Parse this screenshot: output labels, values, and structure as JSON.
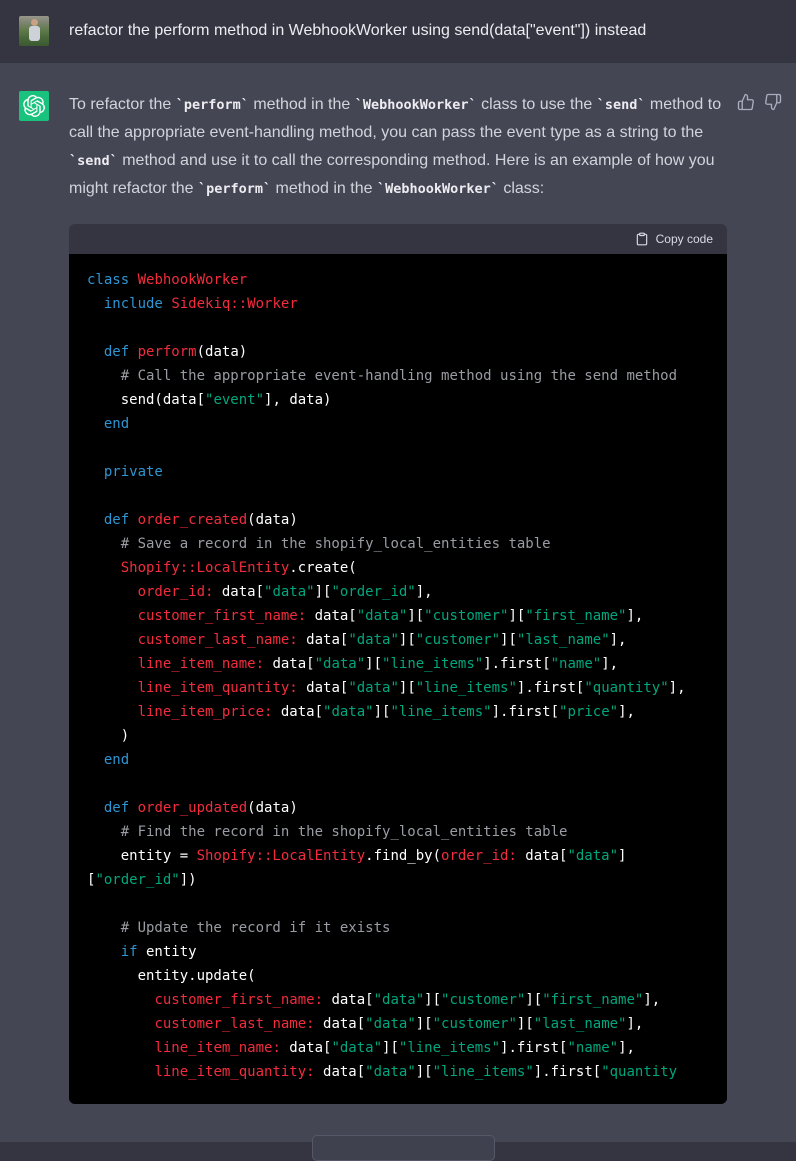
{
  "user_message": {
    "text": "refactor the perform method in WebhookWorker using send(data[\"event\"]) instead"
  },
  "assistant": {
    "paragraph": [
      {
        "v": "To refactor the "
      },
      {
        "v": "`perform`",
        "c": true
      },
      {
        "v": " method in the "
      },
      {
        "v": "`WebhookWorker`",
        "c": true
      },
      {
        "v": " class to use the "
      },
      {
        "v": "`send`",
        "c": true
      },
      {
        "v": " method to call the appropriate event-handling method, you can pass the event type as a string to the "
      },
      {
        "v": "`send`",
        "c": true
      },
      {
        "v": " method and use it to call the corresponding method. Here is an example of how you might refactor the "
      },
      {
        "v": "`perform`",
        "c": true
      },
      {
        "v": " method in the "
      },
      {
        "v": "`WebhookWorker`",
        "c": true
      },
      {
        "v": " class:"
      }
    ]
  },
  "code_block": {
    "copy_label": "Copy code",
    "lines": [
      [
        [
          "k",
          "class"
        ],
        [
          "p",
          " "
        ],
        [
          "t",
          "WebhookWorker"
        ]
      ],
      [
        [
          "p",
          "  "
        ],
        [
          "k",
          "include"
        ],
        [
          "p",
          " "
        ],
        [
          "t",
          "Sidekiq::Worker"
        ]
      ],
      [],
      [
        [
          "p",
          "  "
        ],
        [
          "k",
          "def"
        ],
        [
          "p",
          " "
        ],
        [
          "t",
          "perform"
        ],
        [
          "p",
          "(data)"
        ]
      ],
      [
        [
          "p",
          "    "
        ],
        [
          "c",
          "# Call the appropriate event-handling method using the send method"
        ]
      ],
      [
        [
          "p",
          "    send(data["
        ],
        [
          "s",
          "\"event\""
        ],
        [
          "p",
          "], data)"
        ]
      ],
      [
        [
          "p",
          "  "
        ],
        [
          "k",
          "end"
        ]
      ],
      [],
      [
        [
          "p",
          "  "
        ],
        [
          "k",
          "private"
        ]
      ],
      [],
      [
        [
          "p",
          "  "
        ],
        [
          "k",
          "def"
        ],
        [
          "p",
          " "
        ],
        [
          "t",
          "order_created"
        ],
        [
          "p",
          "(data)"
        ]
      ],
      [
        [
          "p",
          "    "
        ],
        [
          "c",
          "# Save a record in the shopify_local_entities table"
        ]
      ],
      [
        [
          "p",
          "    "
        ],
        [
          "t",
          "Shopify::LocalEntity"
        ],
        [
          "p",
          ".create("
        ]
      ],
      [
        [
          "p",
          "      "
        ],
        [
          "t",
          "order_id:"
        ],
        [
          "p",
          " data["
        ],
        [
          "s",
          "\"data\""
        ],
        [
          "p",
          "]["
        ],
        [
          "s",
          "\"order_id\""
        ],
        [
          "p",
          "],"
        ]
      ],
      [
        [
          "p",
          "      "
        ],
        [
          "t",
          "customer_first_name:"
        ],
        [
          "p",
          " data["
        ],
        [
          "s",
          "\"data\""
        ],
        [
          "p",
          "]["
        ],
        [
          "s",
          "\"customer\""
        ],
        [
          "p",
          "]["
        ],
        [
          "s",
          "\"first_name\""
        ],
        [
          "p",
          "],"
        ]
      ],
      [
        [
          "p",
          "      "
        ],
        [
          "t",
          "customer_last_name:"
        ],
        [
          "p",
          " data["
        ],
        [
          "s",
          "\"data\""
        ],
        [
          "p",
          "]["
        ],
        [
          "s",
          "\"customer\""
        ],
        [
          "p",
          "]["
        ],
        [
          "s",
          "\"last_name\""
        ],
        [
          "p",
          "],"
        ]
      ],
      [
        [
          "p",
          "      "
        ],
        [
          "t",
          "line_item_name:"
        ],
        [
          "p",
          " data["
        ],
        [
          "s",
          "\"data\""
        ],
        [
          "p",
          "]["
        ],
        [
          "s",
          "\"line_items\""
        ],
        [
          "p",
          "].first["
        ],
        [
          "s",
          "\"name\""
        ],
        [
          "p",
          "],"
        ]
      ],
      [
        [
          "p",
          "      "
        ],
        [
          "t",
          "line_item_quantity:"
        ],
        [
          "p",
          " data["
        ],
        [
          "s",
          "\"data\""
        ],
        [
          "p",
          "]["
        ],
        [
          "s",
          "\"line_items\""
        ],
        [
          "p",
          "].first["
        ],
        [
          "s",
          "\"quantity\""
        ],
        [
          "p",
          "],"
        ]
      ],
      [
        [
          "p",
          "      "
        ],
        [
          "t",
          "line_item_price:"
        ],
        [
          "p",
          " data["
        ],
        [
          "s",
          "\"data\""
        ],
        [
          "p",
          "]["
        ],
        [
          "s",
          "\"line_items\""
        ],
        [
          "p",
          "].first["
        ],
        [
          "s",
          "\"price\""
        ],
        [
          "p",
          "],"
        ]
      ],
      [
        [
          "p",
          "    )"
        ]
      ],
      [
        [
          "p",
          "  "
        ],
        [
          "k",
          "end"
        ]
      ],
      [],
      [
        [
          "p",
          "  "
        ],
        [
          "k",
          "def"
        ],
        [
          "p",
          " "
        ],
        [
          "t",
          "order_updated"
        ],
        [
          "p",
          "(data)"
        ]
      ],
      [
        [
          "p",
          "    "
        ],
        [
          "c",
          "# Find the record in the shopify_local_entities table"
        ]
      ],
      [
        [
          "p",
          "    entity = "
        ],
        [
          "t",
          "Shopify::LocalEntity"
        ],
        [
          "p",
          ".find_by("
        ],
        [
          "t",
          "order_id:"
        ],
        [
          "p",
          " data["
        ],
        [
          "s",
          "\"data\""
        ],
        [
          "p",
          "]"
        ]
      ],
      [
        [
          "p",
          "["
        ],
        [
          "s",
          "\"order_id\""
        ],
        [
          "p",
          "])"
        ]
      ],
      [],
      [
        [
          "p",
          "    "
        ],
        [
          "c",
          "# Update the record if it exists"
        ]
      ],
      [
        [
          "p",
          "    "
        ],
        [
          "k",
          "if"
        ],
        [
          "p",
          " entity"
        ]
      ],
      [
        [
          "p",
          "      entity.update("
        ]
      ],
      [
        [
          "p",
          "        "
        ],
        [
          "t",
          "customer_first_name:"
        ],
        [
          "p",
          " data["
        ],
        [
          "s",
          "\"data\""
        ],
        [
          "p",
          "]["
        ],
        [
          "s",
          "\"customer\""
        ],
        [
          "p",
          "]["
        ],
        [
          "s",
          "\"first_name\""
        ],
        [
          "p",
          "],"
        ]
      ],
      [
        [
          "p",
          "        "
        ],
        [
          "t",
          "customer_last_name:"
        ],
        [
          "p",
          " data["
        ],
        [
          "s",
          "\"data\""
        ],
        [
          "p",
          "]["
        ],
        [
          "s",
          "\"customer\""
        ],
        [
          "p",
          "]["
        ],
        [
          "s",
          "\"last_name\""
        ],
        [
          "p",
          "],"
        ]
      ],
      [
        [
          "p",
          "        "
        ],
        [
          "t",
          "line_item_name:"
        ],
        [
          "p",
          " data["
        ],
        [
          "s",
          "\"data\""
        ],
        [
          "p",
          "]["
        ],
        [
          "s",
          "\"line_items\""
        ],
        [
          "p",
          "].first["
        ],
        [
          "s",
          "\"name\""
        ],
        [
          "p",
          "],"
        ]
      ],
      [
        [
          "p",
          "        "
        ],
        [
          "t",
          "line_item_quantity:"
        ],
        [
          "p",
          " data["
        ],
        [
          "s",
          "\"data\""
        ],
        [
          "p",
          "]["
        ],
        [
          "s",
          "\"line_items\""
        ],
        [
          "p",
          "].first["
        ],
        [
          "s",
          "\"quantity"
        ]
      ]
    ]
  },
  "icons": {
    "copy": "clipboard-icon",
    "thumbs_up": "thumbs-up-icon",
    "thumbs_down": "thumbs-down-icon",
    "bot_avatar": "openai-logo-icon"
  },
  "colors": {
    "user_row_bg": "#343541",
    "assistant_row_bg": "#444654",
    "code_bg": "#000000",
    "code_header_bg": "#343541",
    "avatar_green": "#19c37d",
    "token_keyword": "#2e95d3",
    "token_title": "#f22c3d",
    "token_string": "#00a67d",
    "token_comment": "#999da3",
    "body_text": "#d1d5db"
  }
}
